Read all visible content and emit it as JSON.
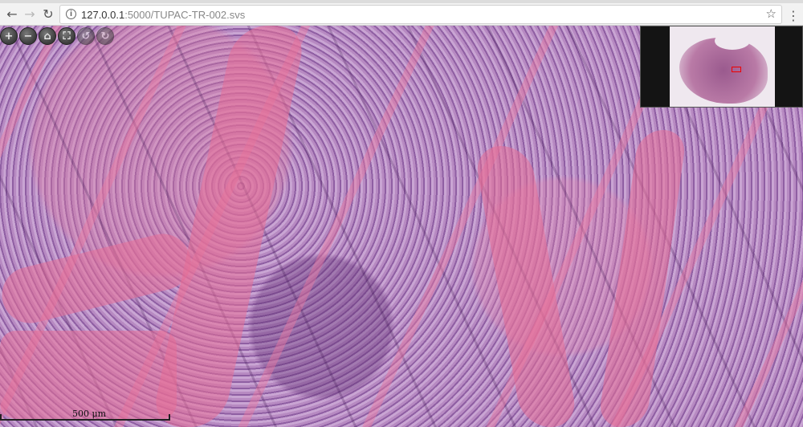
{
  "browser": {
    "back_icon": "back-arrow-icon",
    "forward_icon": "forward-arrow-icon",
    "reload_icon": "reload-icon",
    "url_host": "127.0.0.1",
    "url_rest": ":5000/TUPAC-TR-002.svs",
    "bookmark_icon": "star-icon",
    "menu_icon": "vertical-dots-icon"
  },
  "viewer": {
    "controls": [
      {
        "name": "zoom-in-button",
        "glyph": "+",
        "icon": "zoom-in-icon"
      },
      {
        "name": "zoom-out-button",
        "glyph": "−",
        "icon": "zoom-out-icon"
      },
      {
        "name": "home-button",
        "glyph": "⌂",
        "icon": "home-icon"
      },
      {
        "name": "fullscreen-button",
        "glyph": "⛶",
        "icon": "fullscreen-icon"
      },
      {
        "name": "rotate-left-button",
        "glyph": "↺",
        "icon": "rotate-left-icon"
      },
      {
        "name": "rotate-right-button",
        "glyph": "↻",
        "icon": "rotate-right-icon"
      }
    ],
    "scalebar_label": "500 μm",
    "colors": {
      "stain_purple": "#a77ab8",
      "stroma_pink": "#e06a98",
      "viewport_marker": "#e00000"
    }
  }
}
